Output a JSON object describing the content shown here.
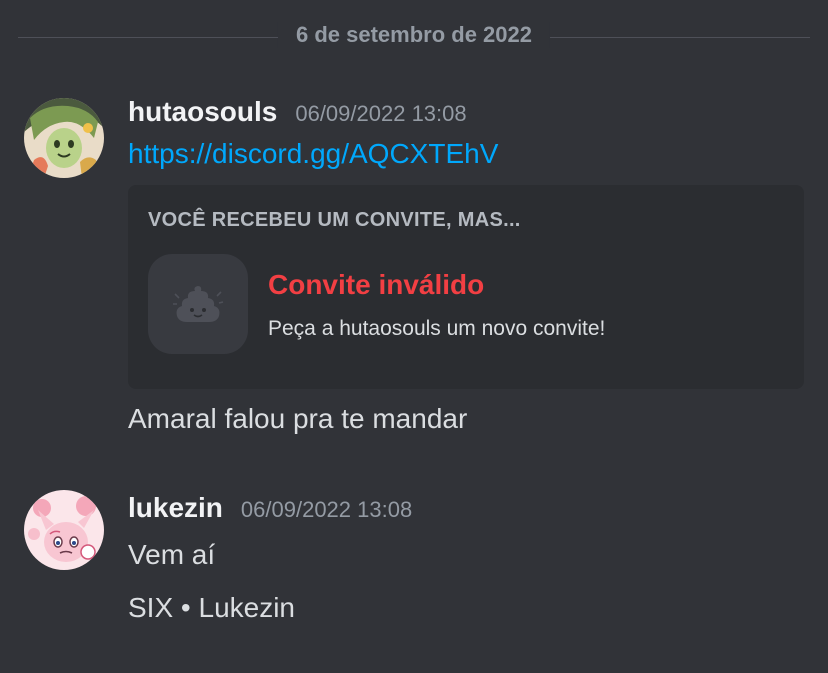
{
  "date_divider": {
    "label": "6 de setembro de 2022"
  },
  "messages": [
    {
      "username": "hutaosouls",
      "timestamp": "06/09/2022 13:08",
      "link": "https://discord.gg/AQCXTEhV",
      "invite_embed": {
        "heading": "VOCÊ RECEBEU UM CONVITE, MAS...",
        "title": "Convite inválido",
        "subtitle": "Peça a hutaosouls um novo convite!",
        "icon": "poop-icon"
      },
      "text": "Amaral falou pra te mandar"
    },
    {
      "username": "lukezin",
      "timestamp": "06/09/2022 13:08",
      "lines": [
        "Vem aí",
        "SIX • Lukezin"
      ]
    }
  ],
  "colors": {
    "background": "#313338",
    "embed_background": "#2b2d31",
    "link": "#00a8fc",
    "error_title": "#f23f43",
    "muted": "#949ba4"
  }
}
